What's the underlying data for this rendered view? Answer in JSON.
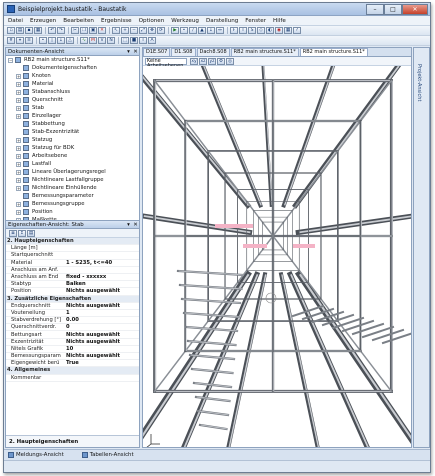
{
  "window": {
    "title": "Beispielprojekt.baustatik - Baustatik"
  },
  "menu": [
    "Datei",
    "Erzeugen",
    "Bearbeiten",
    "Ergebnisse",
    "Optionen",
    "Werkzeug",
    "Darstellung",
    "Fenster",
    "Hilfe"
  ],
  "document_panel": {
    "title": "Dokumenten-Ansicht",
    "tree": [
      {
        "label": "RB2 main structure.S11*",
        "expander": "−",
        "indent": 0,
        "sel": false
      },
      {
        "label": "Dokumenteigenschaften",
        "expander": "",
        "indent": 1,
        "sel": false
      },
      {
        "label": "Knoten",
        "expander": "+",
        "indent": 1,
        "sel": false
      },
      {
        "label": "Material",
        "expander": "+",
        "indent": 1,
        "sel": false
      },
      {
        "label": "Stabanschluss",
        "expander": "+",
        "indent": 1,
        "sel": false
      },
      {
        "label": "Querschnitt",
        "expander": "+",
        "indent": 1,
        "sel": false
      },
      {
        "label": "Stab",
        "expander": "+",
        "indent": 1,
        "sel": false
      },
      {
        "label": "Einzellager",
        "expander": "+",
        "indent": 1,
        "sel": false
      },
      {
        "label": "Stabbettung",
        "expander": "",
        "indent": 1,
        "sel": false
      },
      {
        "label": "Stab-Exzentrizität",
        "expander": "",
        "indent": 1,
        "sel": false
      },
      {
        "label": "Statzug",
        "expander": "+",
        "indent": 1,
        "sel": false
      },
      {
        "label": "Statzug für BDK",
        "expander": "+",
        "indent": 1,
        "sel": false
      },
      {
        "label": "Arbeitsebene",
        "expander": "+",
        "indent": 1,
        "sel": false
      },
      {
        "label": "Lastfall",
        "expander": "+",
        "indent": 1,
        "sel": false
      },
      {
        "label": "Lineare Überlagerungsregel",
        "expander": "+",
        "indent": 1,
        "sel": false
      },
      {
        "label": "Nichtlineare Lastfallgruppe",
        "expander": "+",
        "indent": 1,
        "sel": false
      },
      {
        "label": "Nichtlineare Einhüllende",
        "expander": "+",
        "indent": 1,
        "sel": false
      },
      {
        "label": "Bemessungsparameter",
        "expander": "",
        "indent": 1,
        "sel": false
      },
      {
        "label": "Bemessungsgruppe",
        "expander": "+",
        "indent": 1,
        "sel": false
      },
      {
        "label": "Position",
        "expander": "+",
        "indent": 1,
        "sel": false
      },
      {
        "label": "Maßkette",
        "expander": "+",
        "indent": 1,
        "sel": false
      }
    ]
  },
  "properties_panel": {
    "title": "Eigenschaften-Ansicht: Stab",
    "rows": [
      {
        "cat": true,
        "k": "2. Haupteigenschaften",
        "v": "",
        "bold": false
      },
      {
        "cat": false,
        "k": "Länge [m]",
        "v": "",
        "bold": false
      },
      {
        "cat": false,
        "k": "Startquerschnitt",
        "v": "",
        "bold": false
      },
      {
        "cat": false,
        "k": "Material",
        "v": "1 - S235, t<=40",
        "bold": true
      },
      {
        "cat": false,
        "k": "Anschluss am Anf.",
        "v": "",
        "bold": false
      },
      {
        "cat": false,
        "k": "Anschluss am End",
        "v": "fixed - xxxxxx",
        "bold": true
      },
      {
        "cat": false,
        "k": "Stabtyp",
        "v": "Balken",
        "bold": true
      },
      {
        "cat": false,
        "k": "Position",
        "v": "Nichts ausgewählt",
        "bold": true
      },
      {
        "cat": true,
        "k": "3. Zusätzliche Eigenschaften",
        "v": "",
        "bold": false
      },
      {
        "cat": false,
        "k": "Endquerschnitt",
        "v": "Nichts ausgewählt",
        "bold": true
      },
      {
        "cat": false,
        "k": "Vouteneilung",
        "v": "1",
        "bold": true
      },
      {
        "cat": false,
        "k": "Stabverdrehung [°]",
        "v": "0.00",
        "bold": true
      },
      {
        "cat": false,
        "k": "Querschnittverdr.",
        "v": "0",
        "bold": true
      },
      {
        "cat": false,
        "k": "Bettungsart",
        "v": "Nichts ausgewählt",
        "bold": true
      },
      {
        "cat": false,
        "k": "Exzentrizität",
        "v": "Nichts ausgewählt",
        "bold": true
      },
      {
        "cat": false,
        "k": "Nitels Grafik",
        "v": "10",
        "bold": true
      },
      {
        "cat": false,
        "k": "Bemessungsparam",
        "v": "Nichts ausgewählt",
        "bold": true
      },
      {
        "cat": false,
        "k": "Eigengewicht berü",
        "v": "True",
        "bold": true
      },
      {
        "cat": true,
        "k": "4. Allgemeines",
        "v": "",
        "bold": false
      },
      {
        "cat": false,
        "k": "Kommentar",
        "v": "",
        "bold": false
      }
    ],
    "description": "2. Haupteigenschaften"
  },
  "view_tabs": [
    "D1E.S07",
    "D1.S08",
    "Dach8.S08",
    "RB2 main structure.S11*",
    "RB2 main structure.S11*"
  ],
  "work_plane_combo": "Keine Arbeitsebenen",
  "right_sidebar_label": "Projekt-Ansicht",
  "bottom_tabs": [
    "Meldungs-Ansicht",
    "Tabellen-Ansicht"
  ]
}
